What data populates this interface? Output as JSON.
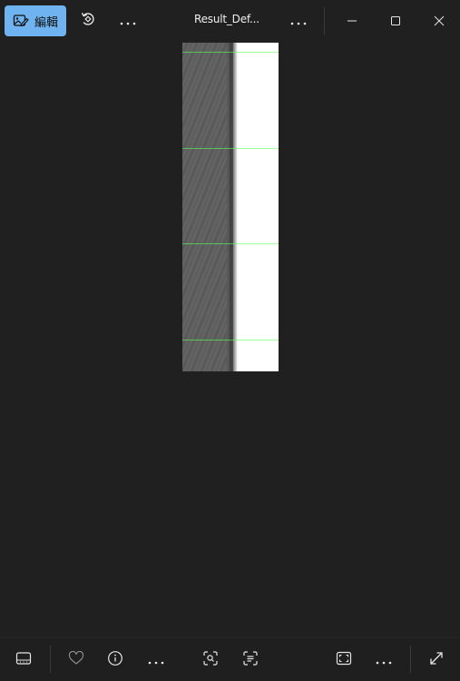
{
  "toolbar": {
    "edit_label": "編輯",
    "edit_icon": "photo-edit-icon",
    "rotate_icon": "rotate-icon",
    "more_icon": "more-horizontal-icon",
    "accent_color": "#6fb4f0"
  },
  "window": {
    "title": "Result_Def...",
    "title_more_icon": "more-horizontal-icon",
    "minimize_icon": "minimize-icon",
    "maximize_icon": "maximize-icon",
    "close_icon": "close-icon"
  },
  "viewer": {
    "image_description_icon": "photo",
    "guide_line_color": "#5aff5a"
  },
  "bottombar": {
    "filmstrip_icon": "filmstrip-icon",
    "favorite_icon": "heart-icon",
    "info_icon": "info-icon",
    "more_icon": "more-horizontal-icon",
    "visual_search_icon": "visual-search-icon",
    "text_scan_icon": "text-scan-icon",
    "fit_icon": "fit-to-window-icon",
    "more2_icon": "more-horizontal-icon",
    "fullscreen_icon": "expand-icon"
  }
}
